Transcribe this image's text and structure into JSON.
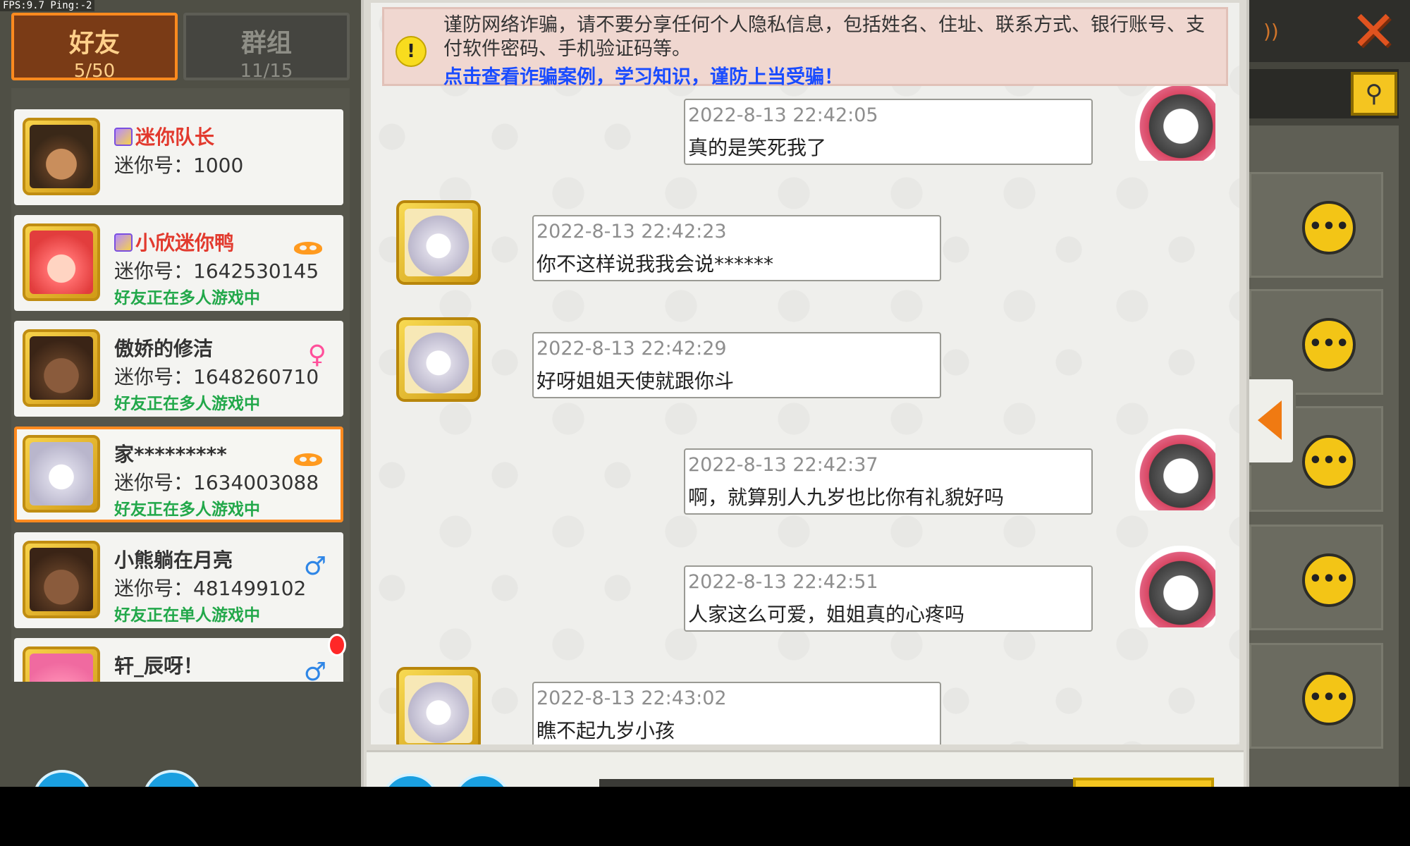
{
  "overlay": {
    "fps_text": "FPS:9.7  Ping:-2"
  },
  "tabs": {
    "friends": {
      "label": "好友",
      "count": "5/50"
    },
    "groups": {
      "label": "群组",
      "count": "11/15"
    }
  },
  "friends": [
    {
      "name": "迷你队长",
      "id_label": "迷你号：1000",
      "status": "",
      "vip": true,
      "badge": "",
      "avatar": "soldier-avatar"
    },
    {
      "name": "小欣迷你鸭",
      "id_label": "迷你号：1642530145",
      "status": "好友正在多人游戏中",
      "vip": true,
      "badge": "mask",
      "avatar": "red-hood-avatar"
    },
    {
      "name": "傲娇的修洁",
      "id_label": "迷你号：1648260710",
      "status": "好友正在多人游戏中",
      "vip": false,
      "badge": "♀",
      "avatar": "brown-hair-avatar"
    },
    {
      "name": "家*********",
      "id_label": "迷你号：1634003088",
      "status": "好友正在多人游戏中",
      "vip": false,
      "badge": "mask",
      "avatar": "silver-hair-avatar",
      "selected": true
    },
    {
      "name": "小熊躺在月亮",
      "id_label": "迷你号：481499102",
      "status": "好友正在单人游戏中",
      "vip": false,
      "badge": "♂",
      "avatar": "brown-hair-avatar"
    },
    {
      "name": "轩_辰呀！",
      "id_label": "",
      "status": "",
      "vip": false,
      "badge": "♂",
      "avatar": "crown-avatar"
    }
  ],
  "warning": {
    "text": "谨防网络诈骗，请不要分享任何个人隐私信息，包括姓名、住址、联系方式、银行账号、支付软件密码、手机验证码等。",
    "link": "点击查看诈骗案例，学习知识，谨防上当受骗！"
  },
  "messages": [
    {
      "side": "right",
      "time": "2022-8-13     22:42:05",
      "text": "真的是笑死我了"
    },
    {
      "side": "left",
      "time": "2022-8-13     22:42:23",
      "text": "你不这样说我我会说******"
    },
    {
      "side": "left",
      "time": "2022-8-13     22:42:29",
      "text": "好呀姐姐天使就跟你斗"
    },
    {
      "side": "right",
      "time": "2022-8-13     22:42:37",
      "text": "啊，就算别人九岁也比你有礼貌好吗"
    },
    {
      "side": "right",
      "time": "2022-8-13     22:42:51",
      "text": "人家这么可爱，姐姐真的心疼吗"
    },
    {
      "side": "left",
      "time": "2022-8-13     22:43:02",
      "text": "瞧不起九岁小孩"
    }
  ],
  "icons": {
    "close": "✕",
    "search": "⚲",
    "chat": "•••",
    "warning": "!",
    "rss": "))"
  },
  "colors": {
    "accent_orange": "#ff8a1f",
    "vip_red": "#e23a2e",
    "status_green": "#22a84a",
    "link_blue": "#1a4cff",
    "button_yellow": "#f4c520"
  }
}
